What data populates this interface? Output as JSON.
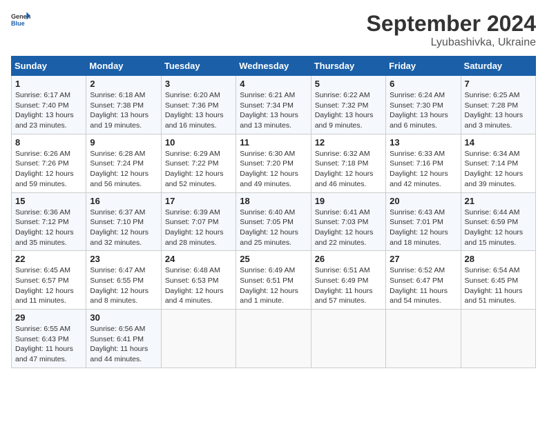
{
  "logo": {
    "line1": "General",
    "line2": "Blue"
  },
  "title": "September 2024",
  "subtitle": "Lyubashivka, Ukraine",
  "days_of_week": [
    "Sunday",
    "Monday",
    "Tuesday",
    "Wednesday",
    "Thursday",
    "Friday",
    "Saturday"
  ],
  "weeks": [
    [
      {
        "day": "1",
        "info": "Sunrise: 6:17 AM\nSunset: 7:40 PM\nDaylight: 13 hours\nand 23 minutes."
      },
      {
        "day": "2",
        "info": "Sunrise: 6:18 AM\nSunset: 7:38 PM\nDaylight: 13 hours\nand 19 minutes."
      },
      {
        "day": "3",
        "info": "Sunrise: 6:20 AM\nSunset: 7:36 PM\nDaylight: 13 hours\nand 16 minutes."
      },
      {
        "day": "4",
        "info": "Sunrise: 6:21 AM\nSunset: 7:34 PM\nDaylight: 13 hours\nand 13 minutes."
      },
      {
        "day": "5",
        "info": "Sunrise: 6:22 AM\nSunset: 7:32 PM\nDaylight: 13 hours\nand 9 minutes."
      },
      {
        "day": "6",
        "info": "Sunrise: 6:24 AM\nSunset: 7:30 PM\nDaylight: 13 hours\nand 6 minutes."
      },
      {
        "day": "7",
        "info": "Sunrise: 6:25 AM\nSunset: 7:28 PM\nDaylight: 13 hours\nand 3 minutes."
      }
    ],
    [
      {
        "day": "8",
        "info": "Sunrise: 6:26 AM\nSunset: 7:26 PM\nDaylight: 12 hours\nand 59 minutes."
      },
      {
        "day": "9",
        "info": "Sunrise: 6:28 AM\nSunset: 7:24 PM\nDaylight: 12 hours\nand 56 minutes."
      },
      {
        "day": "10",
        "info": "Sunrise: 6:29 AM\nSunset: 7:22 PM\nDaylight: 12 hours\nand 52 minutes."
      },
      {
        "day": "11",
        "info": "Sunrise: 6:30 AM\nSunset: 7:20 PM\nDaylight: 12 hours\nand 49 minutes."
      },
      {
        "day": "12",
        "info": "Sunrise: 6:32 AM\nSunset: 7:18 PM\nDaylight: 12 hours\nand 46 minutes."
      },
      {
        "day": "13",
        "info": "Sunrise: 6:33 AM\nSunset: 7:16 PM\nDaylight: 12 hours\nand 42 minutes."
      },
      {
        "day": "14",
        "info": "Sunrise: 6:34 AM\nSunset: 7:14 PM\nDaylight: 12 hours\nand 39 minutes."
      }
    ],
    [
      {
        "day": "15",
        "info": "Sunrise: 6:36 AM\nSunset: 7:12 PM\nDaylight: 12 hours\nand 35 minutes."
      },
      {
        "day": "16",
        "info": "Sunrise: 6:37 AM\nSunset: 7:10 PM\nDaylight: 12 hours\nand 32 minutes."
      },
      {
        "day": "17",
        "info": "Sunrise: 6:39 AM\nSunset: 7:07 PM\nDaylight: 12 hours\nand 28 minutes."
      },
      {
        "day": "18",
        "info": "Sunrise: 6:40 AM\nSunset: 7:05 PM\nDaylight: 12 hours\nand 25 minutes."
      },
      {
        "day": "19",
        "info": "Sunrise: 6:41 AM\nSunset: 7:03 PM\nDaylight: 12 hours\nand 22 minutes."
      },
      {
        "day": "20",
        "info": "Sunrise: 6:43 AM\nSunset: 7:01 PM\nDaylight: 12 hours\nand 18 minutes."
      },
      {
        "day": "21",
        "info": "Sunrise: 6:44 AM\nSunset: 6:59 PM\nDaylight: 12 hours\nand 15 minutes."
      }
    ],
    [
      {
        "day": "22",
        "info": "Sunrise: 6:45 AM\nSunset: 6:57 PM\nDaylight: 12 hours\nand 11 minutes."
      },
      {
        "day": "23",
        "info": "Sunrise: 6:47 AM\nSunset: 6:55 PM\nDaylight: 12 hours\nand 8 minutes."
      },
      {
        "day": "24",
        "info": "Sunrise: 6:48 AM\nSunset: 6:53 PM\nDaylight: 12 hours\nand 4 minutes."
      },
      {
        "day": "25",
        "info": "Sunrise: 6:49 AM\nSunset: 6:51 PM\nDaylight: 12 hours\nand 1 minute."
      },
      {
        "day": "26",
        "info": "Sunrise: 6:51 AM\nSunset: 6:49 PM\nDaylight: 11 hours\nand 57 minutes."
      },
      {
        "day": "27",
        "info": "Sunrise: 6:52 AM\nSunset: 6:47 PM\nDaylight: 11 hours\nand 54 minutes."
      },
      {
        "day": "28",
        "info": "Sunrise: 6:54 AM\nSunset: 6:45 PM\nDaylight: 11 hours\nand 51 minutes."
      }
    ],
    [
      {
        "day": "29",
        "info": "Sunrise: 6:55 AM\nSunset: 6:43 PM\nDaylight: 11 hours\nand 47 minutes."
      },
      {
        "day": "30",
        "info": "Sunrise: 6:56 AM\nSunset: 6:41 PM\nDaylight: 11 hours\nand 44 minutes."
      },
      {
        "day": "",
        "info": ""
      },
      {
        "day": "",
        "info": ""
      },
      {
        "day": "",
        "info": ""
      },
      {
        "day": "",
        "info": ""
      },
      {
        "day": "",
        "info": ""
      }
    ]
  ]
}
